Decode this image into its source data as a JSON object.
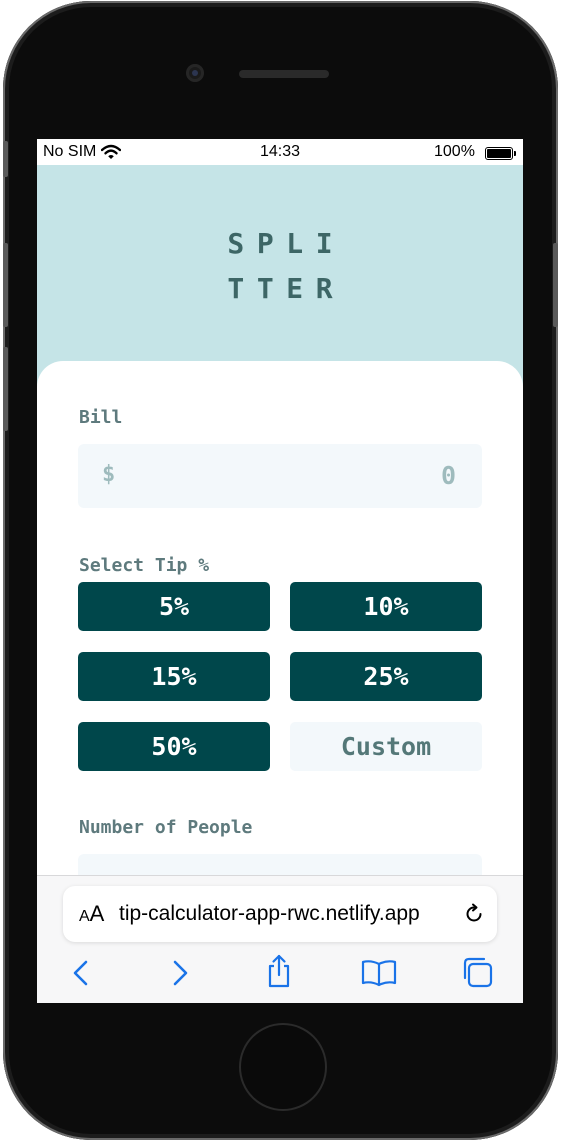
{
  "status_bar": {
    "carrier": "No SIM",
    "time": "14:33",
    "battery": "100%"
  },
  "app": {
    "logo_line1": "SPLI",
    "logo_line2": "TTER",
    "bill": {
      "label": "Bill",
      "currency_symbol": "$",
      "value": "0"
    },
    "tip": {
      "label": "Select Tip %",
      "options": [
        "5%",
        "10%",
        "15%",
        "25%",
        "50%"
      ],
      "custom_placeholder": "Custom"
    },
    "people": {
      "label": "Number of People"
    },
    "colors": {
      "header_bg": "#c5e4e7",
      "accent": "#00474b",
      "input_bg": "#f3f8fb",
      "label_text": "#5e7a7d"
    }
  },
  "browser": {
    "text_size_button": "AA",
    "url": "tip-calculator-app-rwc.netlify.app",
    "icons": [
      "reload-icon",
      "back-icon",
      "forward-icon",
      "share-icon",
      "bookmarks-icon",
      "tabs-icon"
    ]
  }
}
